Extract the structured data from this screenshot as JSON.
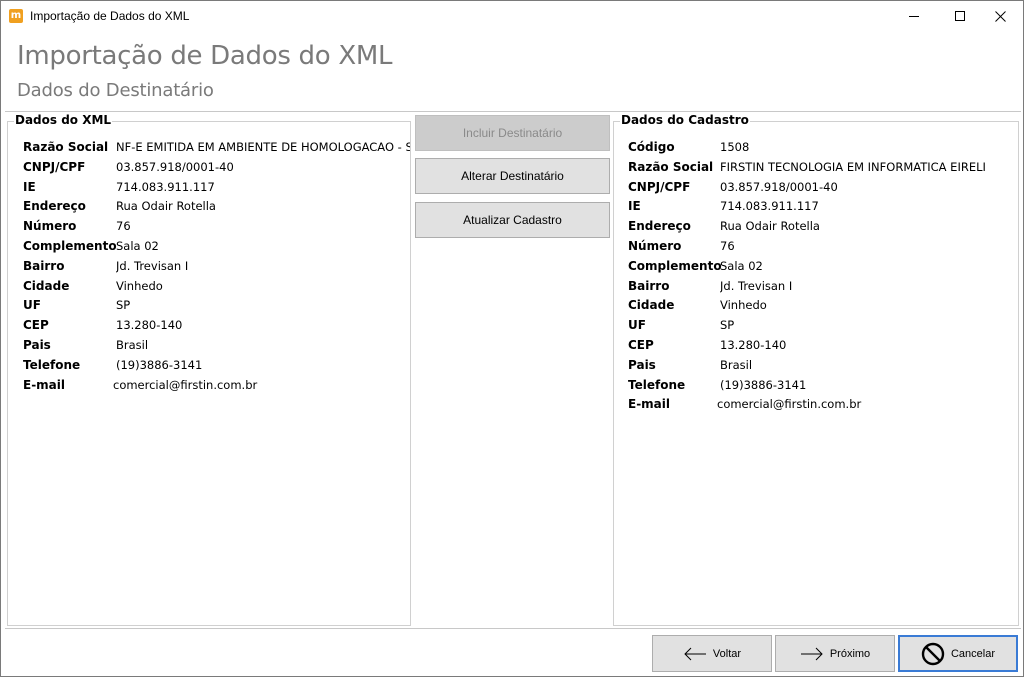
{
  "window": {
    "title": "Importação de Dados do XML",
    "app_icon_letter": "m"
  },
  "header": {
    "title": "Importação de Dados do XML",
    "subtitle": "Dados do Destinatário"
  },
  "xml_group": {
    "legend": "Dados do XML",
    "fields": [
      {
        "label": "Razão Social",
        "value": "NF-E EMITIDA EM AMBIENTE DE HOMOLOGACAO - SEM VALOR FISCAL"
      },
      {
        "label": "CNPJ/CPF",
        "value": "03.857.918/0001-40"
      },
      {
        "label": "IE",
        "value": "714.083.911.117"
      },
      {
        "label": "Endereço",
        "value": "Rua Odair Rotella"
      },
      {
        "label": "Número",
        "value": "76"
      },
      {
        "label": "Complemento",
        "value": "Sala 02"
      },
      {
        "label": "Bairro",
        "value": "Jd. Trevisan I"
      },
      {
        "label": "Cidade",
        "value": "Vinhedo"
      },
      {
        "label": "UF",
        "value": "SP"
      },
      {
        "label": "CEP",
        "value": "13.280-140"
      },
      {
        "label": "Pais",
        "value": "Brasil"
      },
      {
        "label": "Telefone",
        "value": "(19)3886-3141"
      },
      {
        "label": "E-mail",
        "value": "comercial@firstin.com.br"
      }
    ]
  },
  "cadastro_group": {
    "legend": "Dados do Cadastro",
    "fields": [
      {
        "label": "Código",
        "value": "1508"
      },
      {
        "label": "Razão Social",
        "value": "FIRSTIN TECNOLOGIA EM INFORMATICA EIRELI"
      },
      {
        "label": "CNPJ/CPF",
        "value": "03.857.918/0001-40"
      },
      {
        "label": "IE",
        "value": "714.083.911.117"
      },
      {
        "label": "Endereço",
        "value": "Rua Odair Rotella"
      },
      {
        "label": "Número",
        "value": "76"
      },
      {
        "label": "Complemento",
        "value": "Sala 02"
      },
      {
        "label": "Bairro",
        "value": "Jd. Trevisan I"
      },
      {
        "label": "Cidade",
        "value": "Vinhedo"
      },
      {
        "label": "UF",
        "value": "SP"
      },
      {
        "label": "CEP",
        "value": "13.280-140"
      },
      {
        "label": "Pais",
        "value": "Brasil"
      },
      {
        "label": "Telefone",
        "value": "(19)3886-3141"
      },
      {
        "label": "E-mail",
        "value": "comercial@firstin.com.br"
      }
    ]
  },
  "actions": {
    "incluir": "Incluir Destinatário",
    "alterar": "Alterar Destinatário",
    "atualizar": "Atualizar Cadastro"
  },
  "footer": {
    "back": "Voltar",
    "next": "Próximo",
    "cancel": "Cancelar"
  },
  "icons": {
    "app": "app-logo-icon",
    "back": "arrow-left-icon",
    "next": "arrow-right-icon",
    "cancel": "prohibited-icon"
  }
}
